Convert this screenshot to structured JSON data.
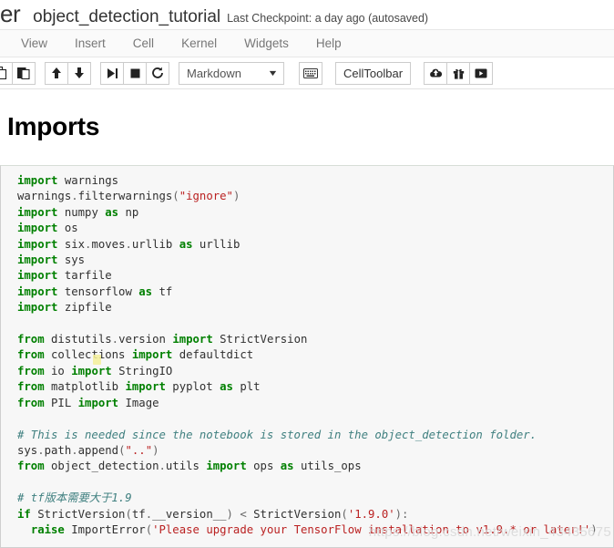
{
  "header": {
    "logo_fragment": "er",
    "notebook_title": "object_detection_tutorial",
    "checkpoint": "Last Checkpoint: a day ago (autosaved)"
  },
  "menubar": {
    "items": [
      {
        "label": "View"
      },
      {
        "label": "Insert"
      },
      {
        "label": "Cell"
      },
      {
        "label": "Kernel"
      },
      {
        "label": "Widgets"
      },
      {
        "label": "Help"
      }
    ]
  },
  "toolbar": {
    "copy_icon": "copy-icon",
    "paste_icon": "paste-icon",
    "move_up_icon": "arrow-up-icon",
    "move_down_icon": "arrow-down-icon",
    "run_icon": "run-cell-icon",
    "stop_icon": "stop-square-icon",
    "restart_icon": "restart-kernel-icon",
    "cell_type_value": "Markdown",
    "cell_type_caret": "▼",
    "command_palette_icon": "keyboard-icon",
    "cell_toolbar_label": "CellToolbar",
    "cloud_icon": "cloud-upload-icon",
    "gift_icon": "gift-icon",
    "play_box_icon": "play-box-icon"
  },
  "notebook": {
    "markdown_heading": "Imports",
    "code_cell": {
      "lines": [
        [
          {
            "t": "import",
            "c": "k"
          },
          {
            "t": " warnings",
            "c": "n"
          }
        ],
        [
          {
            "t": "warnings",
            "c": "n"
          },
          {
            "t": ".",
            "c": "o"
          },
          {
            "t": "filterwarnings",
            "c": "n"
          },
          {
            "t": "(",
            "c": "o"
          },
          {
            "t": "\"ignore\"",
            "c": "s"
          },
          {
            "t": ")",
            "c": "o"
          }
        ],
        [
          {
            "t": "import",
            "c": "k"
          },
          {
            "t": " numpy ",
            "c": "n"
          },
          {
            "t": "as",
            "c": "k"
          },
          {
            "t": " np",
            "c": "n"
          }
        ],
        [
          {
            "t": "import",
            "c": "k"
          },
          {
            "t": " os",
            "c": "n"
          }
        ],
        [
          {
            "t": "import",
            "c": "k"
          },
          {
            "t": " six",
            "c": "n"
          },
          {
            "t": ".",
            "c": "o"
          },
          {
            "t": "moves",
            "c": "n"
          },
          {
            "t": ".",
            "c": "o"
          },
          {
            "t": "urllib ",
            "c": "n"
          },
          {
            "t": "as",
            "c": "k"
          },
          {
            "t": " urllib",
            "c": "n"
          }
        ],
        [
          {
            "t": "import",
            "c": "k"
          },
          {
            "t": " sys",
            "c": "n"
          }
        ],
        [
          {
            "t": "import",
            "c": "k"
          },
          {
            "t": " tarfile",
            "c": "n"
          }
        ],
        [
          {
            "t": "import",
            "c": "k"
          },
          {
            "t": " tensorflow ",
            "c": "n"
          },
          {
            "t": "as",
            "c": "k"
          },
          {
            "t": " tf",
            "c": "n"
          }
        ],
        [
          {
            "t": "import",
            "c": "k"
          },
          {
            "t": " zipfile",
            "c": "n"
          }
        ],
        [],
        [
          {
            "t": "from",
            "c": "k"
          },
          {
            "t": " distutils",
            "c": "n"
          },
          {
            "t": ".",
            "c": "o"
          },
          {
            "t": "version ",
            "c": "n"
          },
          {
            "t": "import",
            "c": "k"
          },
          {
            "t": " StrictVersion",
            "c": "n"
          }
        ],
        [
          {
            "t": "from",
            "c": "k"
          },
          {
            "t": " collections ",
            "c": "n"
          },
          {
            "t": "import",
            "c": "k"
          },
          {
            "t": " defaultdict",
            "c": "n"
          }
        ],
        [
          {
            "t": "from",
            "c": "k"
          },
          {
            "t": " io ",
            "c": "n"
          },
          {
            "t": "import",
            "c": "k"
          },
          {
            "t": " StringIO",
            "c": "n"
          }
        ],
        [
          {
            "t": "from",
            "c": "k"
          },
          {
            "t": " matplotlib ",
            "c": "n"
          },
          {
            "t": "import",
            "c": "k"
          },
          {
            "t": " pyplot ",
            "c": "n"
          },
          {
            "t": "as",
            "c": "k"
          },
          {
            "t": " plt",
            "c": "n"
          }
        ],
        [
          {
            "t": "from",
            "c": "k"
          },
          {
            "t": " PIL ",
            "c": "n"
          },
          {
            "t": "import",
            "c": "k"
          },
          {
            "t": " Image",
            "c": "n"
          }
        ],
        [],
        [
          {
            "t": "# This is needed since the notebook is stored in the object_detection folder.",
            "c": "c"
          }
        ],
        [
          {
            "t": "sys",
            "c": "n"
          },
          {
            "t": ".",
            "c": "o"
          },
          {
            "t": "path",
            "c": "n"
          },
          {
            "t": ".",
            "c": "o"
          },
          {
            "t": "append",
            "c": "n"
          },
          {
            "t": "(",
            "c": "o"
          },
          {
            "t": "\"..\"",
            "c": "s"
          },
          {
            "t": ")",
            "c": "o"
          }
        ],
        [
          {
            "t": "from",
            "c": "k"
          },
          {
            "t": " object_detection",
            "c": "n"
          },
          {
            "t": ".",
            "c": "o"
          },
          {
            "t": "utils ",
            "c": "n"
          },
          {
            "t": "import",
            "c": "k"
          },
          {
            "t": " ops ",
            "c": "n"
          },
          {
            "t": "as",
            "c": "k"
          },
          {
            "t": " utils_ops",
            "c": "n"
          }
        ],
        [],
        [
          {
            "t": "# tf版本需要大于1.9",
            "c": "c"
          }
        ],
        [
          {
            "t": "if",
            "c": "k"
          },
          {
            "t": " StrictVersion",
            "c": "n"
          },
          {
            "t": "(",
            "c": "o"
          },
          {
            "t": "tf",
            "c": "n"
          },
          {
            "t": ".",
            "c": "o"
          },
          {
            "t": "__version__",
            "c": "n"
          },
          {
            "t": ") ",
            "c": "o"
          },
          {
            "t": "<",
            "c": "o"
          },
          {
            "t": " StrictVersion",
            "c": "n"
          },
          {
            "t": "(",
            "c": "o"
          },
          {
            "t": "'1.9.0'",
            "c": "s"
          },
          {
            "t": "):",
            "c": "o"
          }
        ],
        [
          {
            "t": "  ",
            "c": "n"
          },
          {
            "t": "raise",
            "c": "k"
          },
          {
            "t": " ImportError",
            "c": "ne"
          },
          {
            "t": "(",
            "c": "o"
          },
          {
            "t": "'Please upgrade your TensorFlow installation to v1.9.* or later!'",
            "c": "s"
          },
          {
            "t": ")",
            "c": "o"
          }
        ]
      ]
    }
  },
  "watermark": {
    "text": "https://blog.csdn.net/weixin_43435675"
  }
}
